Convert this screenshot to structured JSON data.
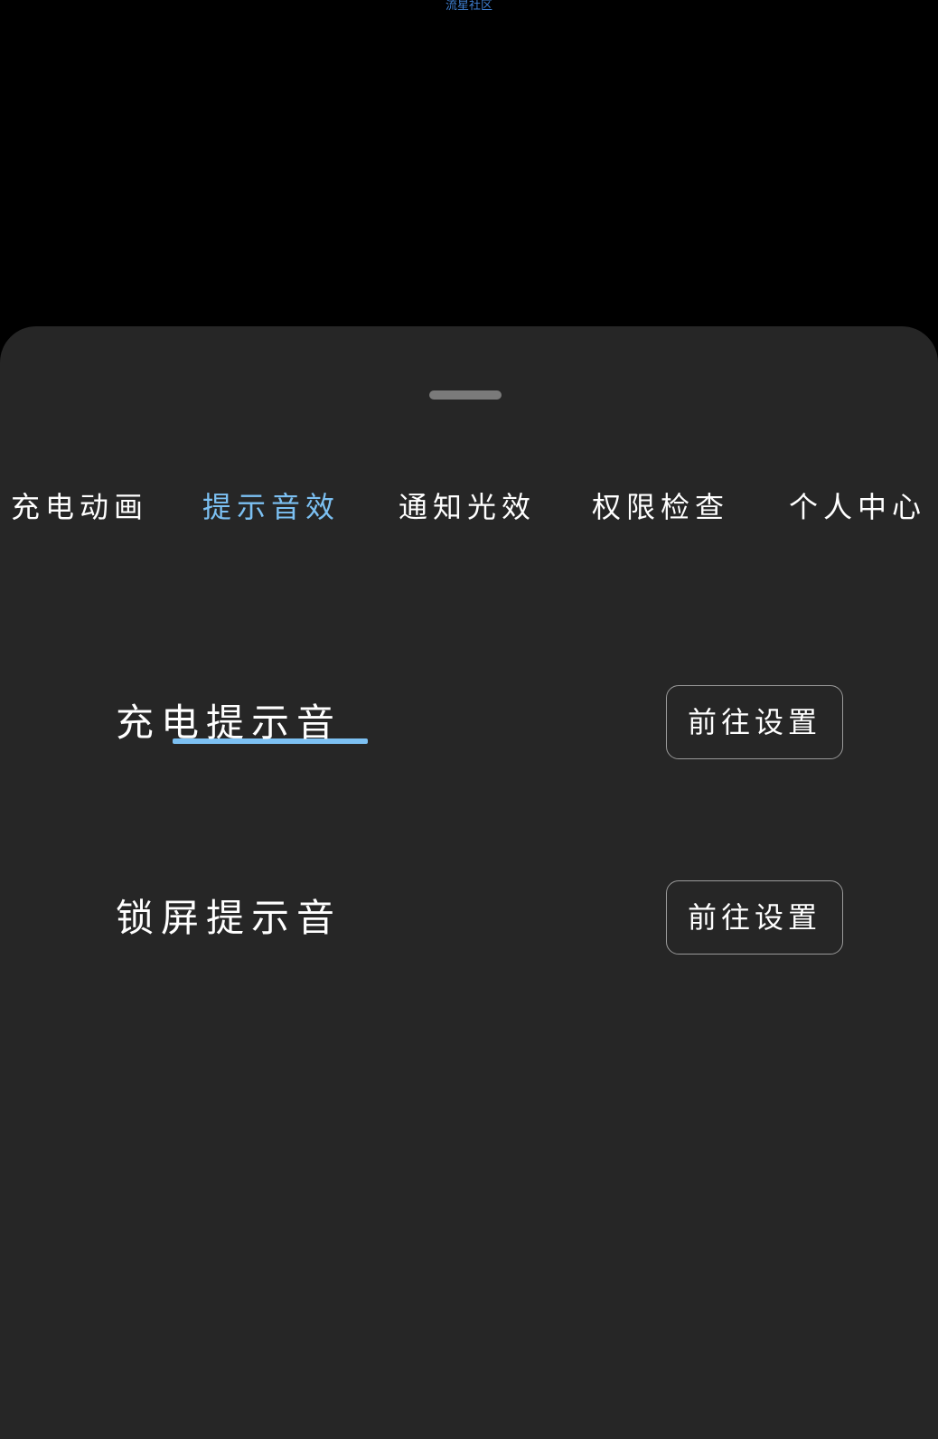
{
  "watermark": "流星社区",
  "tabs": [
    {
      "label": "充电动画",
      "active": false
    },
    {
      "label": "提示音效",
      "active": true
    },
    {
      "label": "通知光效",
      "active": false
    },
    {
      "label": "权限检查",
      "active": false
    },
    {
      "label": "个人中心",
      "active": false
    }
  ],
  "settings": [
    {
      "label": "充电提示音",
      "button": "前往设置"
    },
    {
      "label": "锁屏提示音",
      "button": "前往设置"
    }
  ],
  "colors": {
    "background": "#000000",
    "sheet": "#262626",
    "accent": "#7cc0f2",
    "text": "#ffffff",
    "handle": "#7a7a7a",
    "button_border": "#9a9a9a"
  }
}
